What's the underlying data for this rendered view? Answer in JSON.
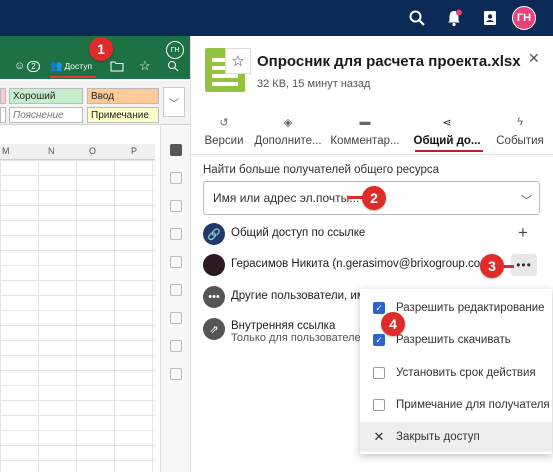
{
  "topbar": {
    "avatar_initials": "ГН"
  },
  "excel": {
    "avatar_initials": "ГН",
    "access_label": "Доступ",
    "badge_count": "2",
    "styles": [
      {
        "label": "Хороший",
        "bg": "#c6efce"
      },
      {
        "label": "Ввод",
        "bg": "#ffcc99"
      },
      {
        "label": "Пояснение",
        "bg": "#ffffff"
      },
      {
        "label": "Примечание",
        "bg": "#ffffcc"
      }
    ],
    "columns": [
      "M",
      "N",
      "O",
      "P"
    ]
  },
  "file": {
    "title": "Опросник для расчета проекта.xlsx",
    "meta": "32 КВ, 15 минут назад"
  },
  "tabs": [
    {
      "label": "Версии",
      "icon": "history-icon"
    },
    {
      "label": "Дополните...",
      "icon": "layers-icon"
    },
    {
      "label": "Комментар...",
      "icon": "comment-icon"
    },
    {
      "label": "Общий до...",
      "icon": "share-icon",
      "active": true
    },
    {
      "label": "События",
      "icon": "bolt-icon"
    }
  ],
  "share": {
    "find_label": "Найти больше получателей общего ресурса",
    "input_placeholder": "Имя или адрес эл.почты...",
    "link_label": "Общий доступ по ссылке",
    "user_label": "Герасимов Никита (n.gerasimov@brixogroup.com)",
    "others_label": "Другие пользователи, име",
    "internal_label": "Внутренняя ссылка",
    "internal_sub": "Только для пользователей"
  },
  "menu": {
    "items": [
      {
        "label": "Разрешить редактирование",
        "checked": true
      },
      {
        "label": "Разрешить скачивать",
        "checked": true
      },
      {
        "label": "Установить срок действия",
        "checked": false
      },
      {
        "label": "Примечание для получателя",
        "checked": false
      }
    ],
    "close_label": "Закрыть доступ"
  },
  "markers": [
    "1",
    "2",
    "3",
    "4"
  ],
  "colors": {
    "topbar": "#0b2a55",
    "excel_green": "#1d7145",
    "accent_red": "#e02b2b",
    "tab_underline": "#c01e2e",
    "file_icon": "#92c240"
  }
}
